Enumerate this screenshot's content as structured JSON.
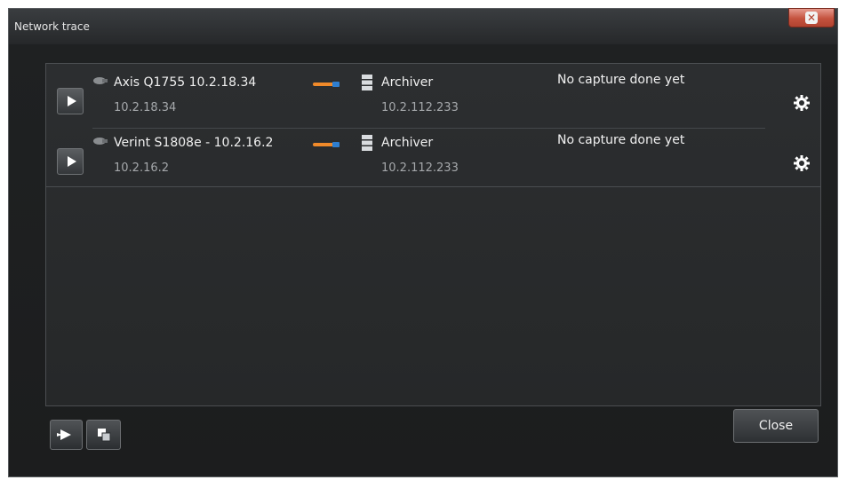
{
  "window": {
    "title": "Network trace",
    "close_icon": "close-x-icon"
  },
  "rows": [
    {
      "device_name": "Axis Q1755 10.2.18.34",
      "device_ip": "10.2.18.34",
      "destination_name": "Archiver",
      "destination_ip": "10.2.112.233",
      "status": "No capture done yet"
    },
    {
      "device_name": "Verint S1808e - 10.2.16.2",
      "device_ip": "10.2.16.2",
      "destination_name": "Archiver",
      "destination_ip": "10.2.112.233",
      "status": "No capture done yet"
    }
  ],
  "footer": {
    "close_label": "Close"
  },
  "colors": {
    "accent_orange": "#f08a2a",
    "accent_blue": "#2f7fd0",
    "close_red": "#c4523e"
  },
  "icons": [
    "play-icon",
    "camera-icon",
    "link-arrow-icon",
    "server-icon",
    "gear-icon",
    "start-all-icon",
    "copy-icon"
  ]
}
